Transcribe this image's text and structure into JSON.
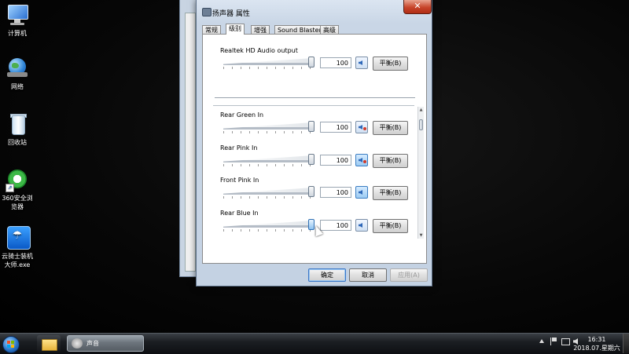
{
  "desktop": {
    "icons": [
      {
        "label": "计算机",
        "icon": "computer-icon"
      },
      {
        "label": "网络",
        "icon": "network-icon"
      },
      {
        "label": "回收站",
        "icon": "recycle-bin-icon"
      },
      {
        "label": "360安全浏览器",
        "icon": "browser-360-icon"
      },
      {
        "label": "云骑士装机大师.exe",
        "icon": "yunqishi-icon"
      }
    ]
  },
  "dialog": {
    "title": "扬声器 属性",
    "close_glyph": "✕",
    "tabs": [
      "常规",
      "级别",
      "增强",
      "Sound Blaster",
      "高级"
    ],
    "active_tab": "级别",
    "main_output": {
      "label": "Realtek HD Audio output",
      "value": "100",
      "balance_label": "平衡(B)"
    },
    "inputs": [
      {
        "label": "Rear Green In",
        "value": "100",
        "balance_label": "平衡(B)",
        "muted": true
      },
      {
        "label": "Rear Pink In",
        "value": "100",
        "balance_label": "平衡(B)",
        "muted": true
      },
      {
        "label": "Front Pink In",
        "value": "100",
        "balance_label": "平衡(B)",
        "muted": false
      },
      {
        "label": "Rear Blue In",
        "value": "100",
        "balance_label": "平衡(B)",
        "muted": false
      }
    ],
    "buttons": {
      "ok": "确定",
      "cancel": "取消",
      "apply": "应用(A)"
    }
  },
  "taskbar": {
    "task_label": "声音",
    "clock_time": "16:31",
    "clock_date": "2018.07.星期六"
  },
  "colors": {
    "accent": "#3a77c8",
    "close_red": "#c7452b",
    "mute_red": "#d23a2a"
  }
}
